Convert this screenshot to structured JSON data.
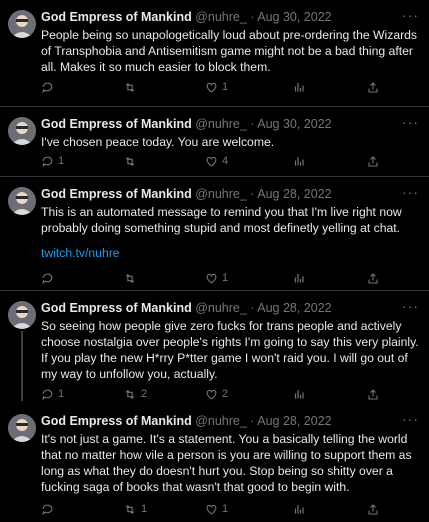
{
  "colors": {
    "background": "#000000",
    "text": "#e7e9ea",
    "muted": "#71767b",
    "link": "#1d9bf0",
    "divider": "#2f3336"
  },
  "tweets": [
    {
      "name": "God Empress of Mankind",
      "meta": "@nuhre_ · Aug 30, 2022",
      "text": "People being so unapologetically loud about pre-ordering the Wizards of Transphobia and Antisemitism game might not be a bad thing after all. Makes it so much easier to block them.",
      "link": "",
      "replies": "",
      "retweets": "",
      "likes": "1",
      "views": ""
    },
    {
      "name": "God Empress of Mankind",
      "meta": "@nuhre_ · Aug 30, 2022",
      "text": "I've chosen peace today. You are welcome.",
      "link": "",
      "replies": "1",
      "retweets": "",
      "likes": "4",
      "views": ""
    },
    {
      "name": "God Empress of Mankind",
      "meta": "@nuhre_ · Aug 28, 2022",
      "text": "This is an automated message to remind you that I'm live right now probably doing something stupid and most definetly yelling at chat.",
      "link": "twitch.tv/nuhre",
      "replies": "",
      "retweets": "",
      "likes": "1",
      "views": ""
    },
    {
      "name": "God Empress of Mankind",
      "meta": "@nuhre_ · Aug 28, 2022",
      "text": "So seeing how people give zero fucks for trans people and actively choose nostalgia over people's rights I'm going to say this very plainly. If you play the new H*rry P*tter game I won't raid you. I will go out of my way to unfollow you, actually.",
      "link": "",
      "replies": "1",
      "retweets": "2",
      "likes": "2",
      "views": ""
    },
    {
      "name": "God Empress of Mankind",
      "meta": "@nuhre_ · Aug 28, 2022",
      "text": "It's not just a game. It's a statement. You a basically telling the world that no matter how vile a person is you are willing to support them as long as what they do doesn't hurt you. Stop being so shitty over a fucking saga of books that wasn't that good to begin with.",
      "link": "",
      "replies": "",
      "retweets": "1",
      "likes": "1",
      "views": ""
    }
  ]
}
